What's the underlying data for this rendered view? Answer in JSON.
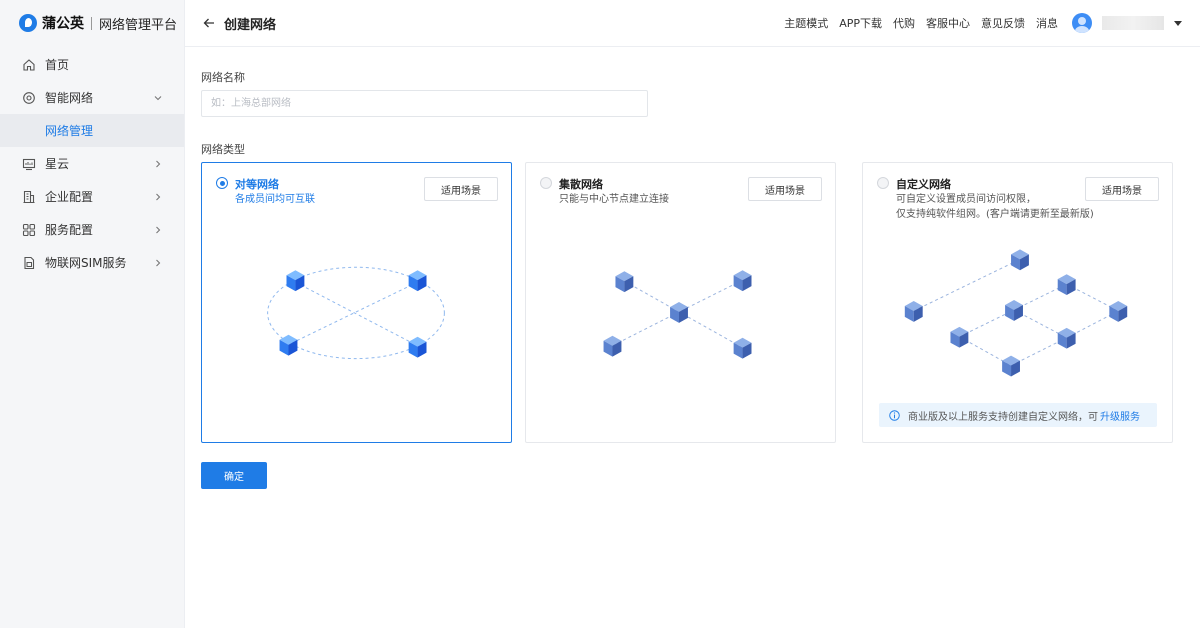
{
  "brand": {
    "name": "蒲公英",
    "subtitle": "网络管理平台"
  },
  "sidebar": {
    "items": [
      {
        "label": "首页",
        "icon": "home-icon"
      },
      {
        "label": "智能网络",
        "icon": "network-icon",
        "expanded": true,
        "children": [
          {
            "label": "网络管理",
            "active": true
          }
        ]
      },
      {
        "label": "星云",
        "icon": "cloud-icon"
      },
      {
        "label": "企业配置",
        "icon": "building-icon"
      },
      {
        "label": "服务配置",
        "icon": "grid-icon"
      },
      {
        "label": "物联网SIM服务",
        "icon": "sim-icon"
      }
    ]
  },
  "header": {
    "title": "创建网络",
    "links": [
      "主题模式",
      "APP下载",
      "代购",
      "客服中心",
      "意见反馈",
      "消息"
    ]
  },
  "form": {
    "name_label": "网络名称",
    "name_placeholder": "如：上海总部网络",
    "name_value": "",
    "type_label": "网络类型",
    "confirm_label": "确定"
  },
  "cards": [
    {
      "title": "对等网络",
      "desc": "各成员间均可互联",
      "button": "适用场景",
      "selected": true
    },
    {
      "title": "集散网络",
      "desc": "只能与中心节点建立连接",
      "button": "适用场景",
      "selected": false
    },
    {
      "title": "自定义网络",
      "desc": "可自定义设置成员间访问权限，",
      "desc2": "仅支持纯软件组网。(客户端请更新至最新版)",
      "button": "适用场景",
      "selected": false,
      "notice": "商业版及以上服务支持创建自定义网络，可",
      "notice_link": "升级服务"
    }
  ],
  "colors": {
    "accent": "#1f7ce6",
    "sidebar_bg": "#f5f6f8",
    "notice_bg": "#eaf4fd"
  }
}
